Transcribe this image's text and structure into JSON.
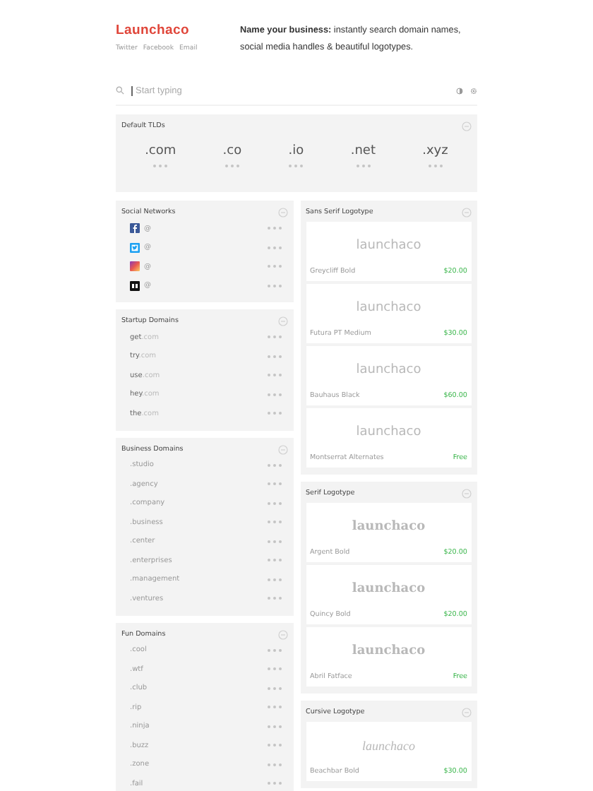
{
  "brand": {
    "name": "Launchaco",
    "links": [
      "Twitter",
      "Facebook",
      "Email"
    ]
  },
  "tagline": "**Name your business:** instantly search domain names, social media handles & beautiful logotypes.",
  "search": {
    "placeholder": "Start typing"
  },
  "default_tlds": {
    "title": "Default TLDs",
    "items": [
      ".com",
      ".co",
      ".io",
      ".net",
      ".xyz"
    ]
  },
  "left_panels": [
    {
      "title": "Social Networks",
      "kind": "social",
      "items": [
        {
          "kind": "facebook",
          "handle": "@"
        },
        {
          "kind": "twitter",
          "handle": "@"
        },
        {
          "kind": "instagram",
          "handle": "@"
        },
        {
          "kind": "medium",
          "handle": "@"
        }
      ]
    },
    {
      "title": "Startup Domains",
      "kind": "domain",
      "items": [
        {
          "name": "get",
          "suffix": ".com"
        },
        {
          "name": "try",
          "suffix": ".com"
        },
        {
          "name": "use",
          "suffix": ".com"
        },
        {
          "name": "hey",
          "suffix": ".com"
        },
        {
          "name": "the",
          "suffix": ".com"
        }
      ]
    },
    {
      "title": "Business Domains",
      "kind": "tld",
      "items": [
        ".studio",
        ".agency",
        ".company",
        ".business",
        ".center",
        ".enterprises",
        ".management",
        ".ventures"
      ]
    },
    {
      "title": "Fun Domains",
      "kind": "tld",
      "items": [
        ".cool",
        ".wtf",
        ".club",
        ".rip",
        ".ninja",
        ".buzz",
        ".zone",
        ".fail"
      ]
    }
  ],
  "logo_panels": [
    {
      "title": "Sans Serif Logotype",
      "kind": "sans",
      "cards": [
        {
          "sample": "launchaco",
          "font": "Greycliff Bold",
          "price": "$20.00"
        },
        {
          "sample": "launchaco",
          "font": "Futura PT Medium",
          "price": "$30.00"
        },
        {
          "sample": "launchaco",
          "font": "Bauhaus Black",
          "price": "$60.00"
        },
        {
          "sample": "launchaco",
          "font": "Montserrat Alternates",
          "price": "Free"
        }
      ]
    },
    {
      "title": "Serif Logotype",
      "kind": "serif",
      "cards": [
        {
          "sample": "launchaco",
          "font": "Argent Bold",
          "price": "$20.00"
        },
        {
          "sample": "launchaco",
          "font": "Quincy Bold",
          "price": "$20.00"
        },
        {
          "sample": "launchaco",
          "font": "Abril Fatface",
          "price": "Free"
        }
      ]
    },
    {
      "title": "Cursive Logotype",
      "kind": "cursive",
      "cards": [
        {
          "sample": "launchaco",
          "font": "Beachbar Bold",
          "price": "$30.00"
        }
      ]
    }
  ]
}
